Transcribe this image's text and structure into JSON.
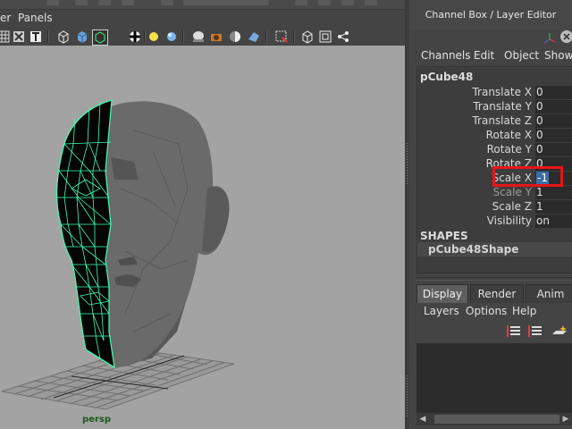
{
  "viewport": {
    "menu": {
      "view_fragment": "er",
      "panels": "Panels"
    },
    "camera_label": "persp",
    "icons": [
      "grid-toggle-icon",
      "isolate-icon",
      "text-icon",
      "wireframe-cube-icon",
      "smooth-shaded-cube-icon",
      "xray-selected-icon",
      "checker-icon",
      "light-sphere-icon",
      "default-light-icon",
      "lit-sphere-icon",
      "camera-icon",
      "half-sphere-icon",
      "ambient-occlusion-icon",
      "select-region-icon",
      "cube-frame-icon",
      "resolution-gate-icon",
      "node-graph-icon"
    ]
  },
  "channel_box": {
    "title": "Channel Box / Layer Editor",
    "menu": [
      "Channels",
      "Edit",
      "Object",
      "Show"
    ],
    "object_name": "pCube48",
    "attributes": [
      {
        "label": "Translate X",
        "value": "0"
      },
      {
        "label": "Translate Y",
        "value": "0"
      },
      {
        "label": "Translate Z",
        "value": "0"
      },
      {
        "label": "Rotate X",
        "value": "0"
      },
      {
        "label": "Rotate Y",
        "value": "0"
      },
      {
        "label": "Rotate Z",
        "value": "0"
      },
      {
        "label": "Scale X",
        "value": "-1"
      },
      {
        "label": "Scale Y",
        "value": "1"
      },
      {
        "label": "Scale Z",
        "value": "1"
      },
      {
        "label": "Visibility",
        "value": "on"
      }
    ],
    "shapes_header": "SHAPES",
    "shape_name": "pCube48Shape"
  },
  "layer_editor": {
    "tabs": [
      "Display",
      "Render",
      "Anim"
    ],
    "active_tab": "Display",
    "menu": [
      "Layers",
      "Options",
      "Help"
    ]
  },
  "colors": {
    "highlight": "#e8141a",
    "wireframe": "#3dffb0",
    "selection": "#3b6ea7"
  }
}
